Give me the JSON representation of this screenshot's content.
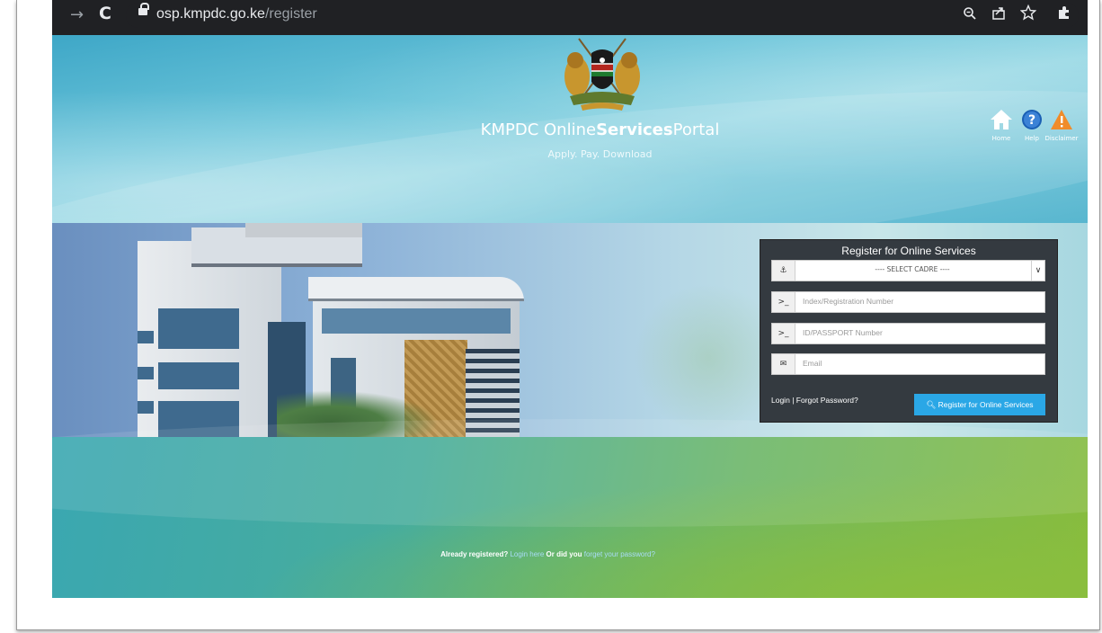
{
  "browser": {
    "url_host": "osp.kmpdc.go.ke",
    "url_path": "/register",
    "forward_icon": "→",
    "reload_icon": "C"
  },
  "header": {
    "title_part1": "KMPDC Online",
    "title_part2": "Services",
    "title_part3": "Portal",
    "subtitle": "Apply. Pay. Download",
    "icons": [
      {
        "name": "home-icon",
        "label": "Home"
      },
      {
        "name": "help-icon",
        "label": "Help"
      },
      {
        "name": "disclaimer-icon",
        "label": "Disclaimer"
      }
    ]
  },
  "register": {
    "title": "Register for Online Services",
    "cadre_selected": "---- SELECT CADRE ----",
    "index_placeholder": "Index/Registration Number",
    "id_placeholder": "ID/PASSPORT Number",
    "email_placeholder": "Email",
    "login_link": "Login",
    "separator": "|",
    "forgot_link": "Forgot Password?",
    "button_label": "Register for Online Services"
  },
  "footer": {
    "text1": "Already registered?",
    "link1": "Login here",
    "text2": "Or did you",
    "link2": "forget your password?"
  },
  "colors": {
    "panel_bg": "#343a40",
    "button_bg": "#2aa7e6",
    "browser_bar": "#202124"
  }
}
